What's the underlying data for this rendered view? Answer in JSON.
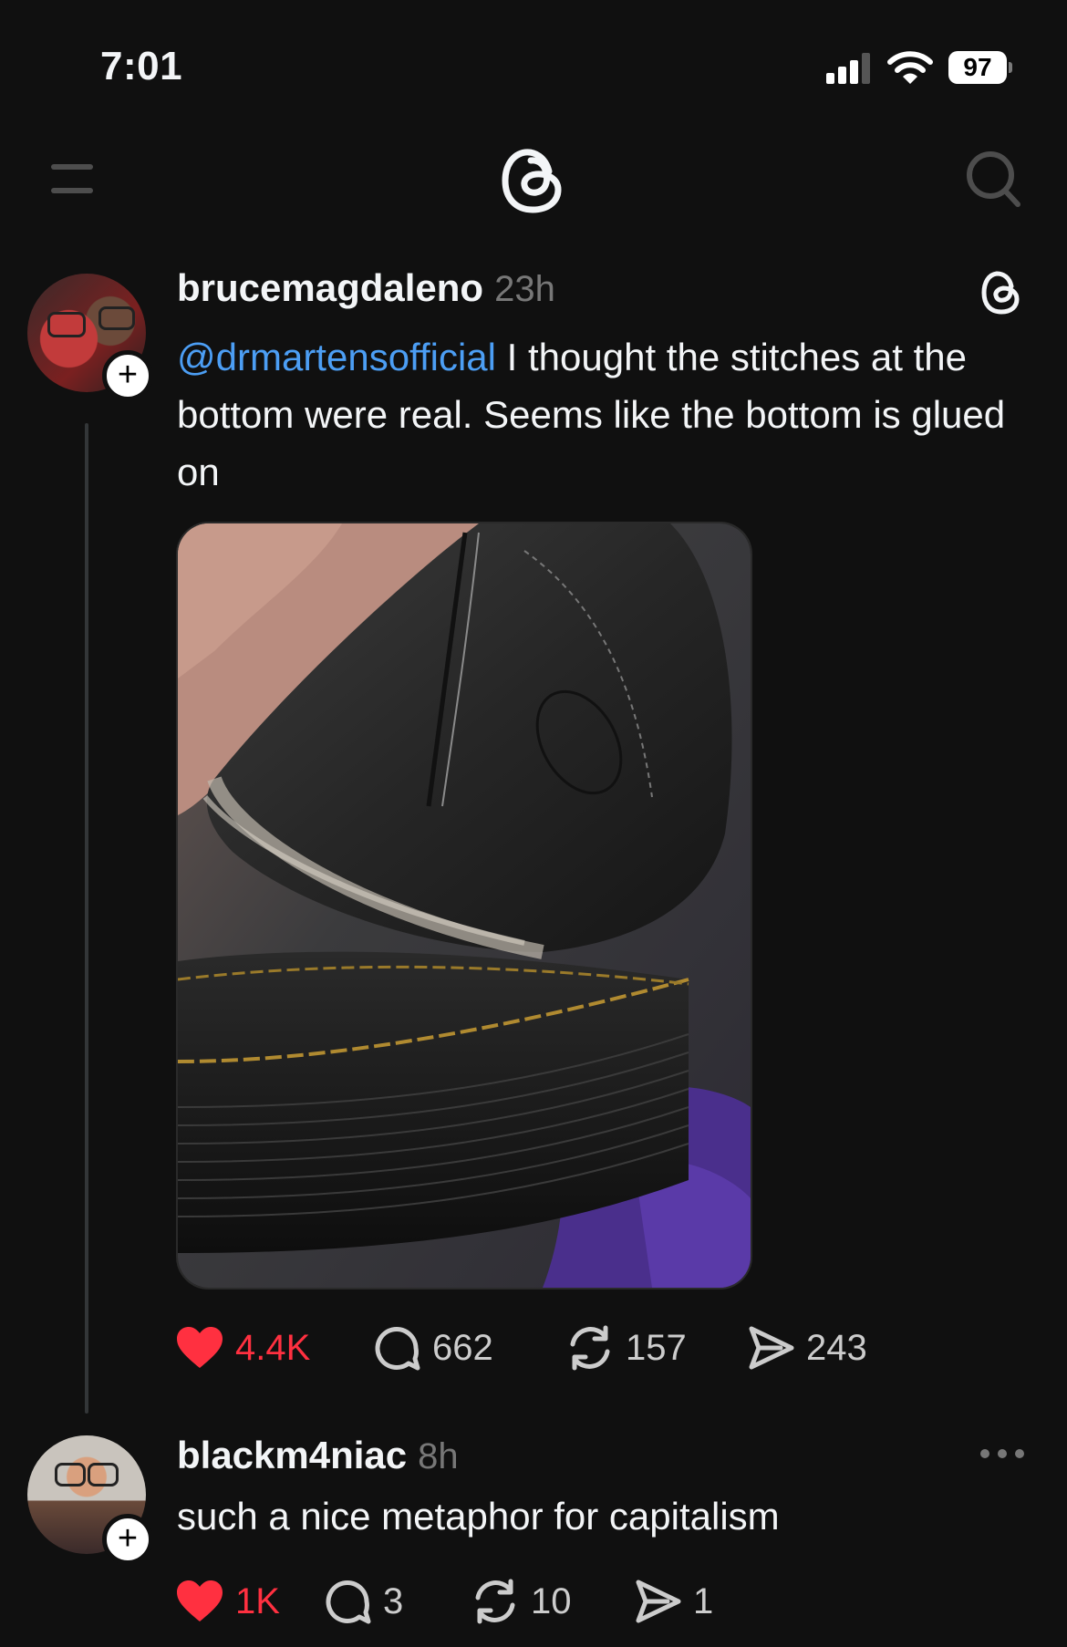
{
  "status_bar": {
    "time": "7:01",
    "battery": "97"
  },
  "nav": {
    "menu_icon": "menu-icon",
    "logo_icon": "threads-logo",
    "search_icon": "search-icon"
  },
  "post": {
    "username": "brucemagdaleno",
    "time": "23h",
    "mention": "@drmartensofficial",
    "text": " I thought the stitches at the bottom were real. Seems like the bottom is glued on",
    "stats": {
      "likes": "4.4K",
      "replies": "662",
      "reposts": "157",
      "shares": "243"
    }
  },
  "reply": {
    "username": "blackm4niac",
    "time": "8h",
    "text": "such a nice metaphor for capitalism",
    "stats": {
      "likes": "1K",
      "replies": "3",
      "reposts": "10",
      "shares": "1"
    }
  },
  "colors": {
    "background": "#101010",
    "mention": "#4c9ef4",
    "like": "#ff3040"
  }
}
